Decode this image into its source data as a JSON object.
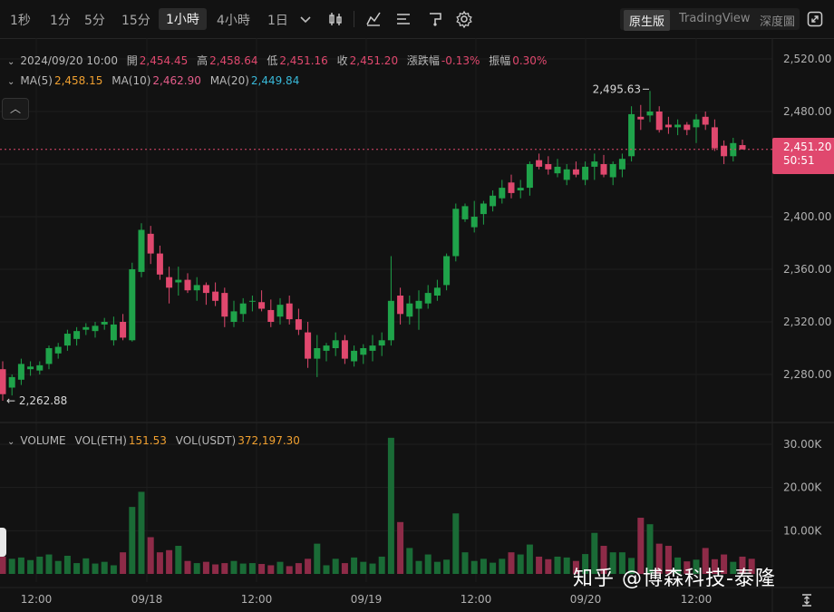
{
  "toolbar": {
    "timeframes": [
      "1秒",
      "1分",
      "5分",
      "15分",
      "1小時",
      "4小時",
      "1日"
    ],
    "active_timeframe": "1小時",
    "views": [
      "原生版",
      "TradingView",
      "深度圖"
    ],
    "active_view": "原生版",
    "icons": [
      "dropdown-chevron-icon",
      "candle-type-icon",
      "indicator-icon",
      "settings-list-icon",
      "drawing-tool-icon",
      "gear-icon",
      "fullscreen-icon"
    ]
  },
  "ohlc_info": {
    "datetime": "2024/09/20 10:00",
    "open_label": "開",
    "open": "2,454.45",
    "high_label": "高",
    "high": "2,458.64",
    "low_label": "低",
    "low": "2,451.16",
    "close_label": "收",
    "close": "2,451.20",
    "change_label": "漲跌幅",
    "change": "-0.13%",
    "amplitude_label": "振幅",
    "amplitude": "0.30%"
  },
  "ma_info": {
    "ma5_label": "MA(5)",
    "ma5": "2,458.15",
    "ma10_label": "MA(10)",
    "ma10": "2,462.90",
    "ma20_label": "MA(20)",
    "ma20": "2,449.84"
  },
  "volume_info": {
    "title": "VOLUME",
    "vol_eth_label": "VOL(ETH)",
    "vol_eth": "151.53",
    "vol_usdt_label": "VOL(USDT)",
    "vol_usdt": "372,197.30"
  },
  "price_tag": {
    "price": "2,451.20",
    "countdown": "50:51"
  },
  "annotations": {
    "high": "2,495.63",
    "low": "← 2,262.88"
  },
  "watermark": "知乎 @博森科技-泰隆",
  "colors": {
    "up": "#1fa34a",
    "down": "#e0486e",
    "background": "#121212",
    "accent": "#e0486e"
  },
  "chart_data": [
    {
      "type": "candlestick",
      "title": "",
      "ylim": [
        2250,
        2525
      ],
      "y_ticks": [
        "2,520.00",
        "2,480.00",
        "2,440.00",
        "2,400.00",
        "2,360.00",
        "2,320.00",
        "2,280.00"
      ],
      "x_ticks": [
        "12:00",
        "09/18",
        "12:00",
        "09/19",
        "12:00",
        "09/20",
        "12:00"
      ],
      "series": [
        {
          "ohlc": [
            [
              2284,
              2290,
              2260,
              2265
            ],
            [
              2270,
              2280,
              2264,
              2278
            ],
            [
              2276,
              2292,
              2272,
              2288
            ],
            [
              2284,
              2290,
              2279,
              2286
            ],
            [
              2283,
              2290,
              2280,
              2287
            ],
            [
              2288,
              2302,
              2284,
              2300
            ],
            [
              2296,
              2304,
              2292,
              2301
            ],
            [
              2302,
              2314,
              2298,
              2311
            ],
            [
              2307,
              2316,
              2302,
              2313
            ],
            [
              2314,
              2319,
              2310,
              2316
            ],
            [
              2313,
              2320,
              2308,
              2317
            ],
            [
              2318,
              2323,
              2314,
              2320
            ],
            [
              2306,
              2324,
              2302,
              2318
            ],
            [
              2320,
              2326,
              2306,
              2308
            ],
            [
              2306,
              2365,
              2305,
              2360
            ],
            [
              2358,
              2395,
              2354,
              2390
            ],
            [
              2387,
              2393,
              2364,
              2372
            ],
            [
              2372,
              2378,
              2352,
              2356
            ],
            [
              2354,
              2362,
              2334,
              2346
            ],
            [
              2350,
              2362,
              2340,
              2352
            ],
            [
              2352,
              2357,
              2342,
              2344
            ],
            [
              2344,
              2354,
              2336,
              2348
            ],
            [
              2348,
              2350,
              2333,
              2342
            ],
            [
              2343,
              2350,
              2332,
              2336
            ],
            [
              2342,
              2346,
              2316,
              2324
            ],
            [
              2320,
              2336,
              2316,
              2328
            ],
            [
              2326,
              2338,
              2320,
              2334
            ],
            [
              2336,
              2340,
              2328,
              2336
            ],
            [
              2335,
              2344,
              2328,
              2330
            ],
            [
              2329,
              2337,
              2316,
              2320
            ],
            [
              2324,
              2338,
              2318,
              2333
            ],
            [
              2334,
              2340,
              2318,
              2322
            ],
            [
              2322,
              2330,
              2310,
              2314
            ],
            [
              2312,
              2320,
              2285,
              2292
            ],
            [
              2292,
              2310,
              2278,
              2300
            ],
            [
              2298,
              2304,
              2290,
              2302
            ],
            [
              2300,
              2312,
              2294,
              2306
            ],
            [
              2306,
              2310,
              2288,
              2292
            ],
            [
              2290,
              2302,
              2286,
              2298
            ],
            [
              2295,
              2303,
              2288,
              2300
            ],
            [
              2298,
              2310,
              2290,
              2302
            ],
            [
              2302,
              2312,
              2294,
              2306
            ],
            [
              2306,
              2370,
              2302,
              2336
            ],
            [
              2340,
              2346,
              2318,
              2326
            ],
            [
              2324,
              2340,
              2318,
              2334
            ],
            [
              2330,
              2344,
              2314,
              2336
            ],
            [
              2334,
              2348,
              2330,
              2342
            ],
            [
              2340,
              2352,
              2336,
              2346
            ],
            [
              2348,
              2372,
              2344,
              2370
            ],
            [
              2370,
              2410,
              2366,
              2406
            ],
            [
              2398,
              2410,
              2396,
              2408
            ],
            [
              2392,
              2412,
              2388,
              2400
            ],
            [
              2402,
              2412,
              2394,
              2410
            ],
            [
              2408,
              2420,
              2404,
              2416
            ],
            [
              2414,
              2428,
              2410,
              2422
            ],
            [
              2426,
              2432,
              2414,
              2418
            ],
            [
              2420,
              2428,
              2414,
              2422
            ],
            [
              2422,
              2442,
              2416,
              2440
            ],
            [
              2443,
              2448,
              2436,
              2438
            ],
            [
              2440,
              2446,
              2432,
              2436
            ],
            [
              2433,
              2444,
              2430,
              2438
            ],
            [
              2428,
              2440,
              2424,
              2436
            ],
            [
              2436,
              2442,
              2430,
              2432
            ],
            [
              2428,
              2442,
              2424,
              2438
            ],
            [
              2438,
              2448,
              2428,
              2442
            ],
            [
              2440,
              2447,
              2430,
              2432
            ],
            [
              2430,
              2442,
              2424,
              2440
            ],
            [
              2436,
              2448,
              2430,
              2444
            ],
            [
              2446,
              2484,
              2442,
              2478
            ],
            [
              2476,
              2485,
              2466,
              2474
            ],
            [
              2477,
              2495.63,
              2472,
              2480
            ],
            [
              2480,
              2484,
              2464,
              2466
            ],
            [
              2470,
              2476,
              2463,
              2468
            ],
            [
              2468,
              2474,
              2462,
              2470
            ],
            [
              2470,
              2472,
              2462,
              2466
            ],
            [
              2468,
              2478,
              2456,
              2474
            ],
            [
              2476,
              2480,
              2466,
              2470
            ],
            [
              2468,
              2474,
              2450,
              2452
            ],
            [
              2454,
              2458,
              2440,
              2446
            ],
            [
              2446,
              2460,
              2442,
              2456
            ],
            [
              2454.45,
              2458.64,
              2451.16,
              2451.2
            ]
          ]
        }
      ],
      "last_price": 2451.2
    },
    {
      "type": "bar",
      "title": "VOLUME",
      "ylim": [
        0,
        33000
      ],
      "y_ticks": [
        "30.00K",
        "20.00K",
        "10.00K"
      ],
      "series": [
        {
          "name": "VOL(ETH)",
          "values": [
            4000,
            3500,
            3800,
            3200,
            4000,
            4500,
            3000,
            4200,
            2500,
            3600,
            2400,
            2800,
            2000,
            5000,
            15500,
            19000,
            8500,
            5000,
            5500,
            6500,
            3000,
            2500,
            2800,
            2200,
            2500,
            3000,
            2400,
            2500,
            2300,
            2000,
            2800,
            1800,
            2500,
            3500,
            7000,
            2000,
            3500,
            2500,
            3800,
            2800,
            2400,
            4000,
            31500,
            12000,
            6000,
            3000,
            4500,
            2800,
            3300,
            14000,
            5000,
            3000,
            3500,
            2600,
            3500,
            5000,
            4500,
            6800,
            4000,
            3400,
            4000,
            3800,
            3000,
            4600,
            9500,
            6500,
            5000,
            5000,
            3700,
            13000,
            11500,
            7000,
            6500,
            3800,
            2900,
            3300,
            6000,
            3400,
            4500,
            2800,
            4000,
            3500
          ]
        }
      ]
    }
  ]
}
